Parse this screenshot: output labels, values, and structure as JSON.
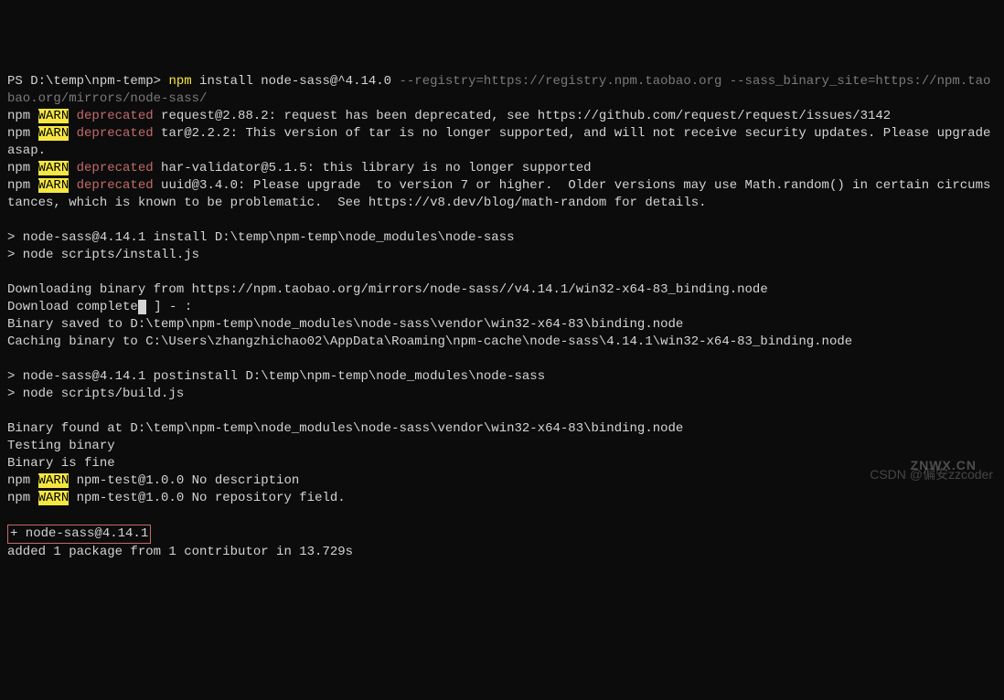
{
  "prompt": "PS D:\\temp\\npm-temp> ",
  "cmd": {
    "npm": "npm ",
    "args": "install node-sass@^4.14.0 ",
    "flags": "--registry=https://registry.npm.taobao.org --sass_binary_site=https://npm.taobao.org/mirrors/node-sass/"
  },
  "warnLines": [
    {
      "prefix": "npm ",
      "warn": "WARN",
      "space": " ",
      "dep": "deprecated",
      "rest": " request@2.88.2: request has been deprecated, see https://github.com/request/request/issues/3142"
    },
    {
      "prefix": "npm ",
      "warn": "WARN",
      "space": " ",
      "dep": "deprecated",
      "rest": " tar@2.2.2: This version of tar is no longer supported, and will not receive security updates. Please upgrade asap."
    },
    {
      "prefix": "npm ",
      "warn": "WARN",
      "space": " ",
      "dep": "deprecated",
      "rest": " har-validator@5.1.5: this library is no longer supported"
    },
    {
      "prefix": "npm ",
      "warn": "WARN",
      "space": " ",
      "dep": "deprecated",
      "rest": " uuid@3.4.0: Please upgrade  to version 7 or higher.  Older versions may use Math.random() in certain circumstances, which is known to be problematic.  See https://v8.dev/blog/math-random for details."
    }
  ],
  "installHeader": "\n> node-sass@4.14.1 install D:\\temp\\npm-temp\\node_modules\\node-sass\n> node scripts/install.js\n",
  "download": {
    "from": "\nDownloading binary from https://npm.taobao.org/mirrors/node-sass//v4.14.1/win32-x64-83_binding.node",
    "completePrefix": "Download complete",
    "completeSuffix": " ] - :",
    "saved": "Binary saved to D:\\temp\\npm-temp\\node_modules\\node-sass\\vendor\\win32-x64-83\\binding.node",
    "cached": "Caching binary to C:\\Users\\zhangzhichao02\\AppData\\Roaming\\npm-cache\\node-sass\\4.14.1\\win32-x64-83_binding.node"
  },
  "postinstallHeader": "\n> node-sass@4.14.1 postinstall D:\\temp\\npm-temp\\node_modules\\node-sass\n> node scripts/build.js\n",
  "binary": {
    "found": "\nBinary found at D:\\temp\\npm-temp\\node_modules\\node-sass\\vendor\\win32-x64-83\\binding.node",
    "testing": "Testing binary",
    "fine": "Binary is fine"
  },
  "warnLines2": [
    {
      "prefix": "npm ",
      "warn": "WARN",
      "rest": " npm-test@1.0.0 No description"
    },
    {
      "prefix": "npm ",
      "warn": "WARN",
      "rest": " npm-test@1.0.0 No repository field."
    }
  ],
  "result": {
    "boxed": "+ node-sass@4.14.1",
    "added": "added 1 package from 1 contributor in 13.729s"
  },
  "watermark1": "CSDN @偏安zzcoder",
  "watermark2": "ZNWX.CN"
}
